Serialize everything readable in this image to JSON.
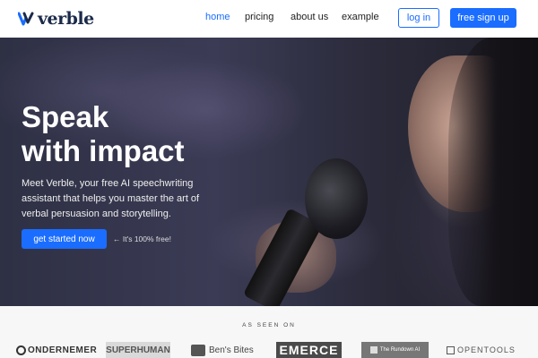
{
  "nav": {
    "brand": "verble",
    "links": [
      "home",
      "pricing",
      "about us",
      "example"
    ],
    "login_label": "log in",
    "signup_label": "free sign up"
  },
  "hero": {
    "headline": "Speak\nwith impact",
    "subtext": "Meet Verble, your free AI speechwriting assistant that helps you master the art of verbal persuasion and storytelling.",
    "cta_label": "get started now",
    "cta_note": "← It's 100% free!"
  },
  "seen_on": {
    "label": "AS SEEN ON",
    "brands": [
      "ONDERNEMER",
      "SUPERHUMAN",
      "Ben's Bites",
      "EMERCE",
      "The Rundown AI",
      "OPENTOOLS"
    ]
  },
  "colors": {
    "accent": "#1a6dff",
    "brand_text": "#1b2a4a"
  }
}
